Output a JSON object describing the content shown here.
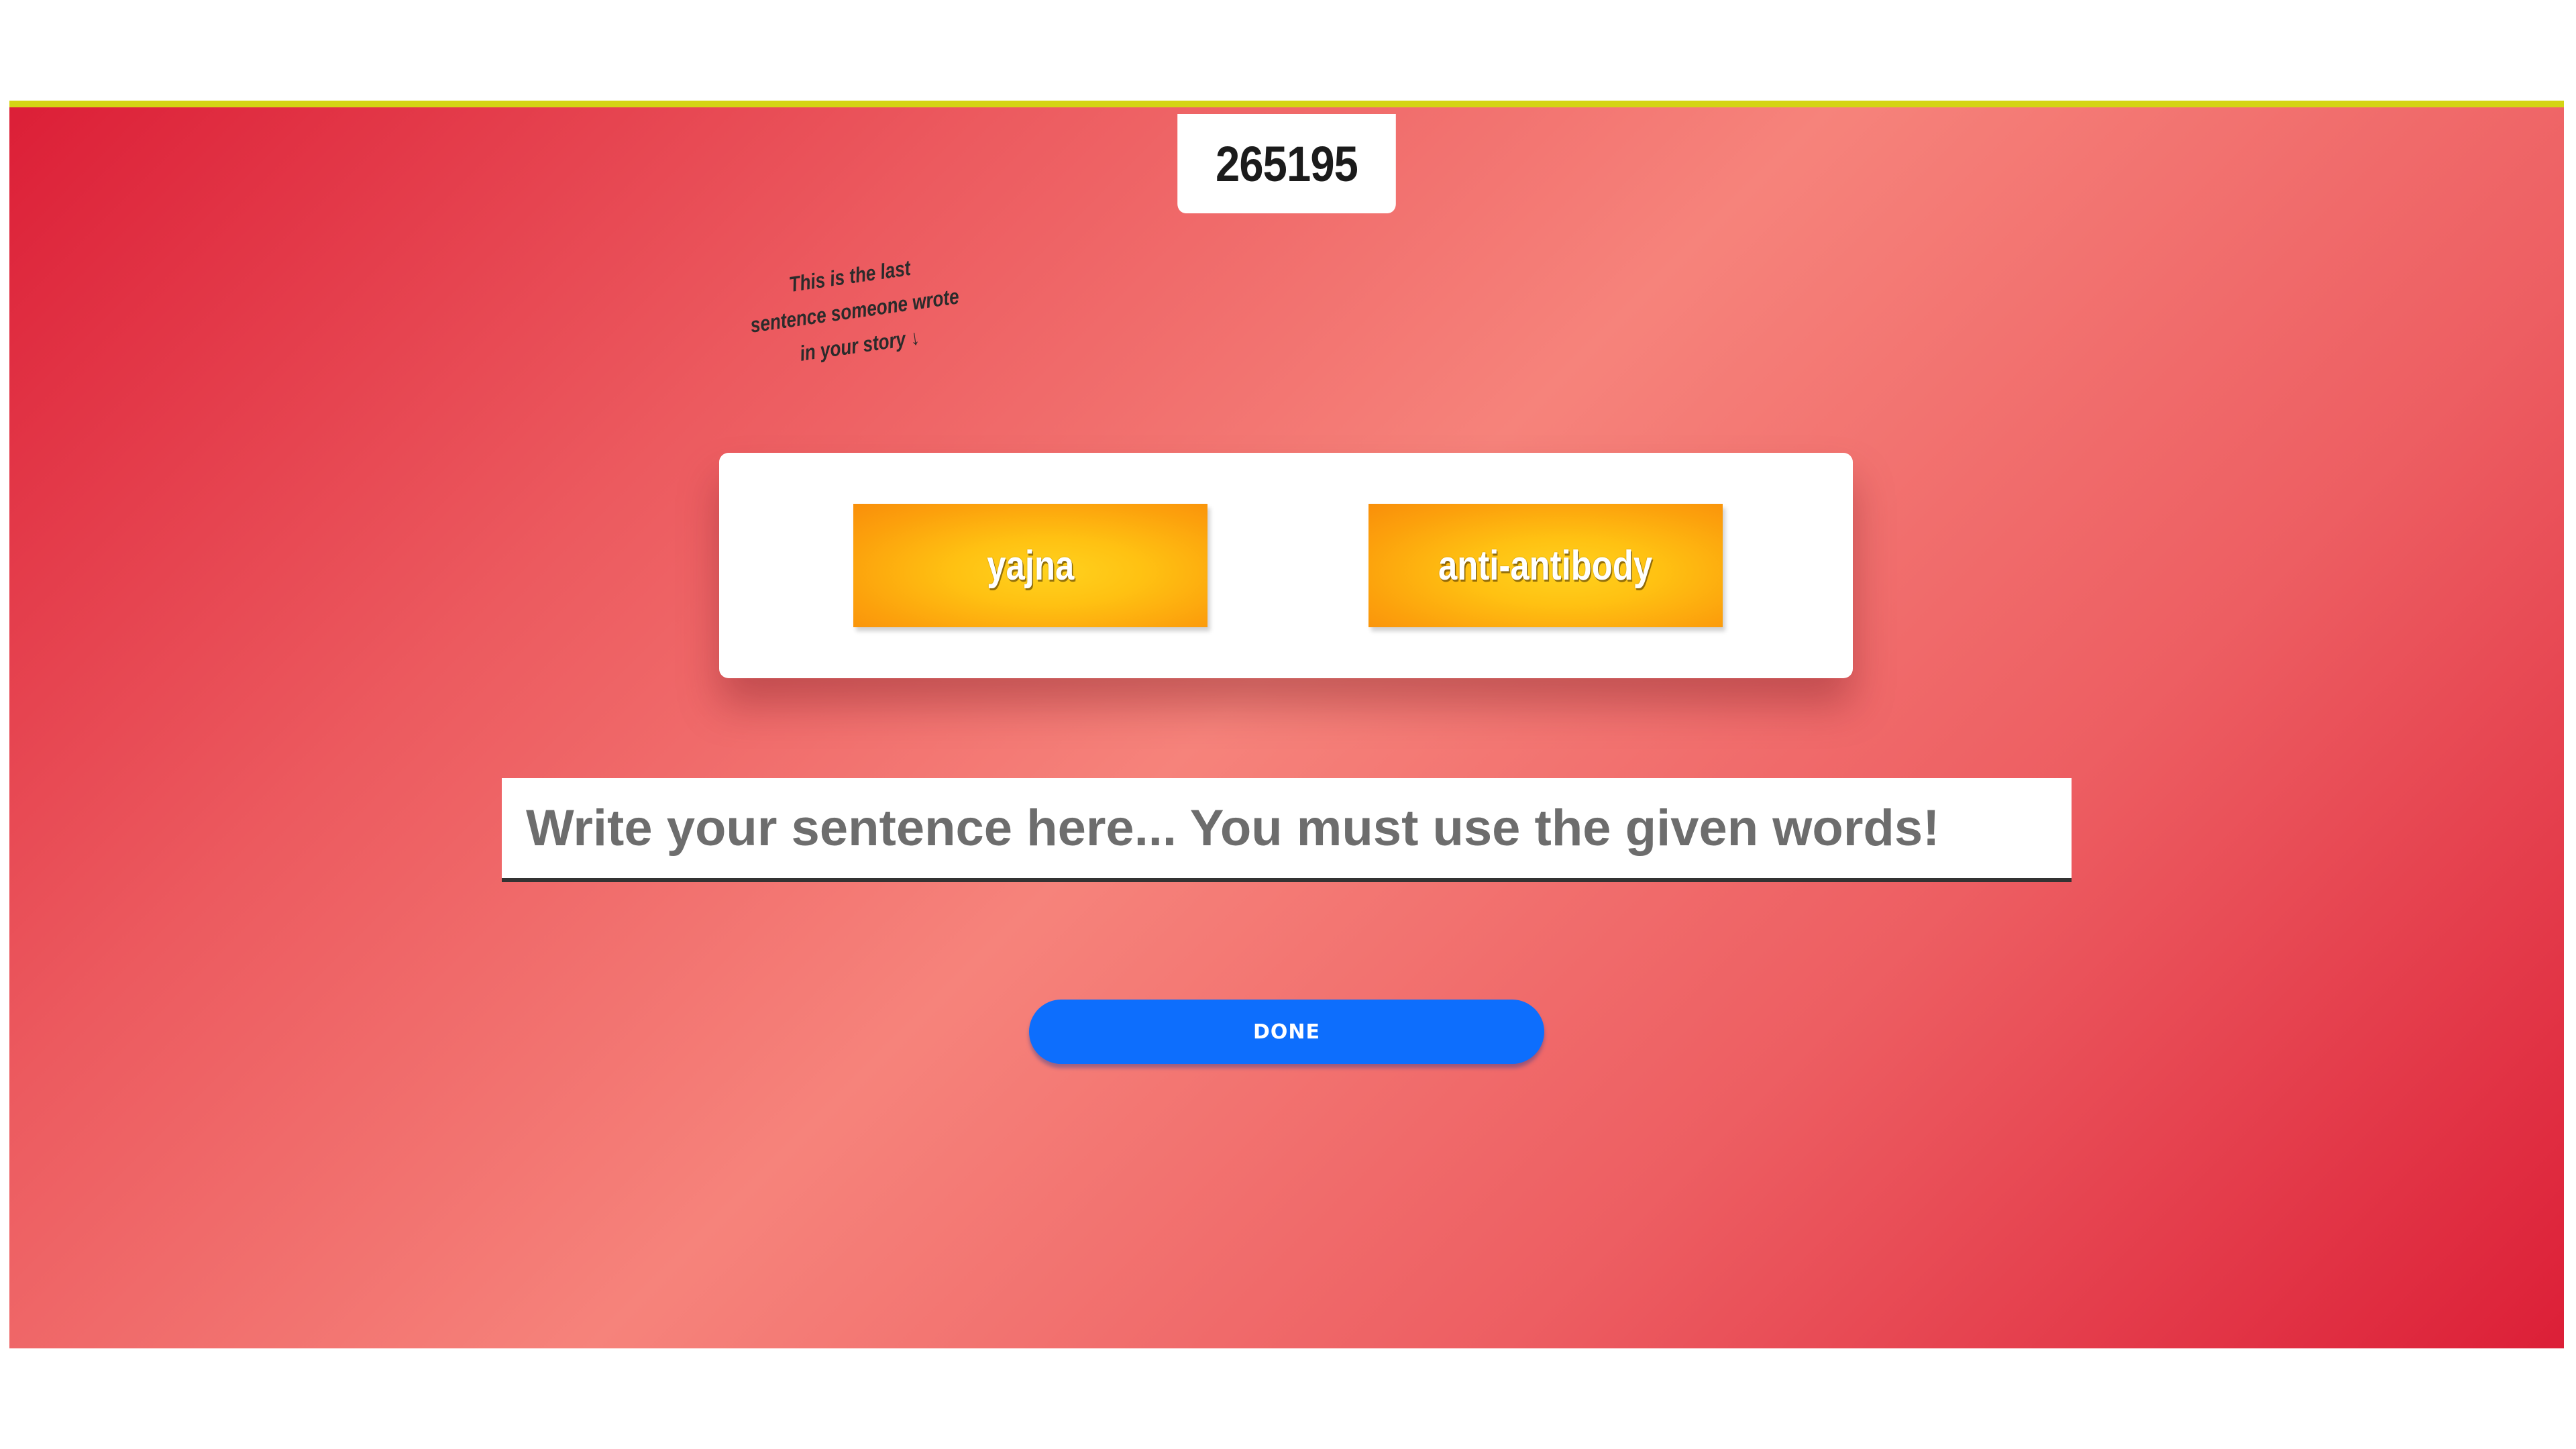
{
  "game": {
    "room_code": "265195",
    "hint_line_1": "This is the last",
    "hint_line_2": "sentence someone wrote",
    "hint_line_3": "in your story ↓",
    "words": [
      {
        "label": "yajna"
      },
      {
        "label": "anti-antibody"
      }
    ],
    "sentence_input": {
      "value": "",
      "placeholder": "Write your sentence here... You must use the given words!"
    },
    "done_label": "DONE"
  },
  "colors": {
    "accent_bar": "#d4d414",
    "background_red": "#dc1f37",
    "background_salmon": "#f6837b",
    "word_chip": "#ffc112",
    "done_button": "#0d6efd"
  }
}
